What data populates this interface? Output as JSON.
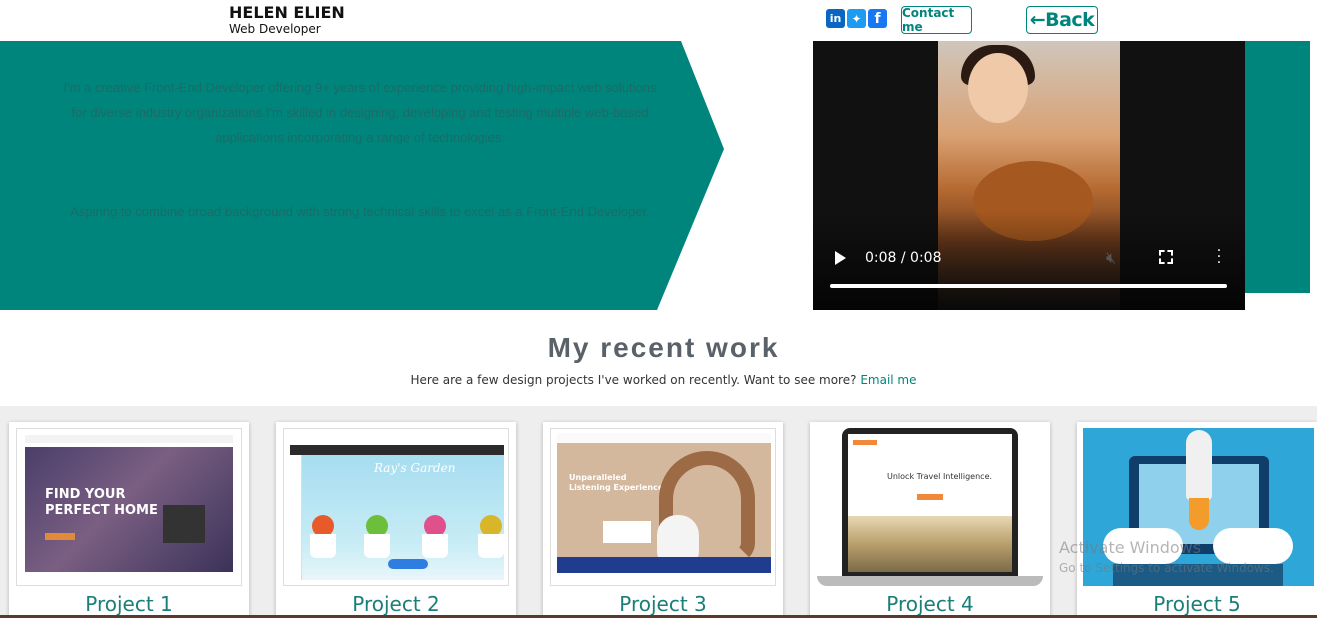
{
  "header": {
    "name": "HELEN ELIEN",
    "role": "Web Developer",
    "contact_label": "Contact me",
    "back_label": "←Back",
    "social": [
      {
        "icon": "linkedin-icon",
        "glyph": "in"
      },
      {
        "icon": "twitter-icon",
        "glyph": "✦"
      },
      {
        "icon": "facebook-icon",
        "glyph": "f"
      }
    ]
  },
  "hero": {
    "paragraph1": "I'm a creative Front-End Developer offering 9+ years of experience providing high-impact web solutions for diverse industry organizations.I'm skilled in designing, developing and testing multiple web-based applications incorporating a range of technologies.",
    "paragraph2": "Aspiring to combine broad background with strong technical skills to excel as a Front-End Developer."
  },
  "video": {
    "time": "0:08 / 0:08",
    "progress": 1.0
  },
  "work": {
    "title": "My recent work",
    "subtitle": "Here are a few design projects I've worked on recently. Want to see more?",
    "email_link": "Email me",
    "projects": [
      {
        "title": "Project 1",
        "thumb_heading": "FIND YOUR\nPERFECT HOME"
      },
      {
        "title": "Project 2",
        "thumb_heading": "Ray's Garden"
      },
      {
        "title": "Project 3",
        "thumb_heading": "Unparalleled\nListening Experience"
      },
      {
        "title": "Project 4",
        "thumb_heading": "Unlock Travel Intelligence."
      },
      {
        "title": "Project 5"
      }
    ]
  },
  "os_watermark": {
    "line1": "Activate Windows",
    "line2": "Go to Settings to activate Windows."
  },
  "colors": {
    "accent": "#00857c",
    "heading": "#5b6168"
  }
}
